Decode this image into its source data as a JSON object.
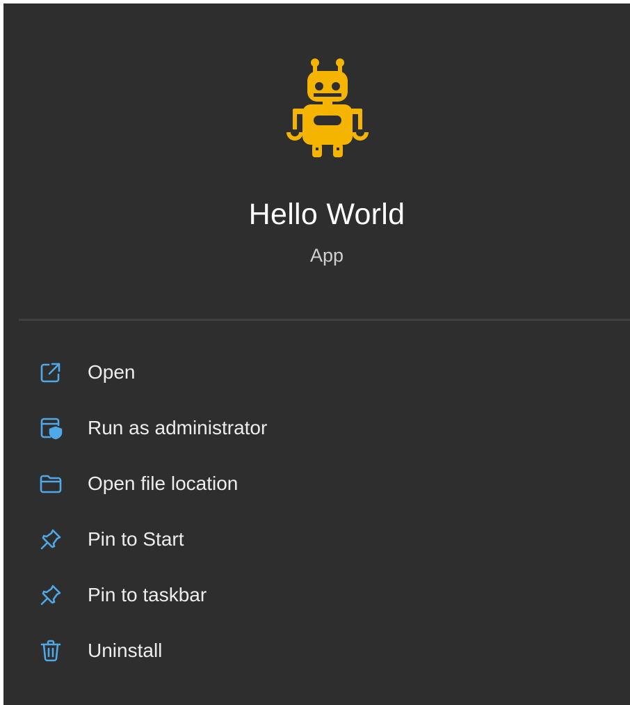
{
  "app": {
    "title": "Hello World",
    "subtitle": "App",
    "icon": "robot-icon",
    "icon_color": "#f4b400"
  },
  "menu": {
    "accent": "#4fa8e8",
    "items": [
      {
        "label": "Open",
        "icon": "open-external-icon"
      },
      {
        "label": "Run as administrator",
        "icon": "run-as-admin-icon"
      },
      {
        "label": "Open file location",
        "icon": "folder-icon"
      },
      {
        "label": "Pin to Start",
        "icon": "pin-icon"
      },
      {
        "label": "Pin to taskbar",
        "icon": "pin-icon"
      },
      {
        "label": "Uninstall",
        "icon": "trash-icon"
      }
    ]
  }
}
